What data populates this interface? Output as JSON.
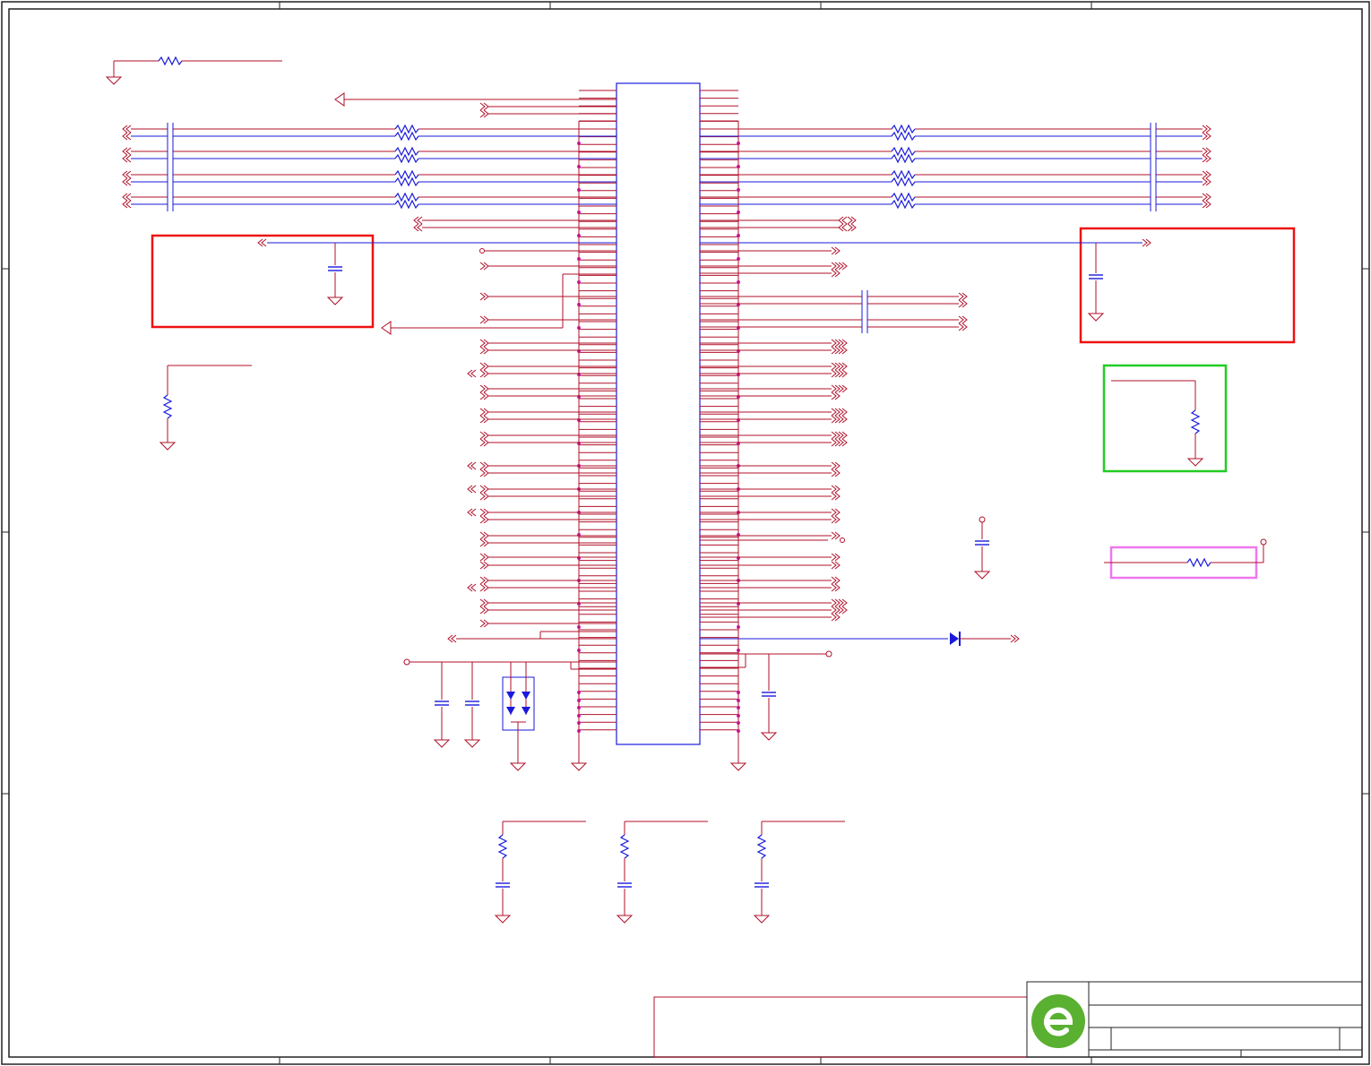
{
  "document": {
    "type": "schematic-sheet",
    "text_labels": []
  },
  "colors": {
    "wire": "#b0102a",
    "part": "#1a1adc",
    "junction": "#d21ed2",
    "frame": "#222222",
    "highlight_red": "#ee1111",
    "highlight_green": "#22cc22",
    "highlight_pink": "#ee77ee",
    "ic_body": "#1a1adc",
    "logo_green": "#5ab030"
  },
  "icons": {
    "logo": "company-logo-icon",
    "ground": "ground-symbol-icon",
    "resistor": "resistor-icon",
    "capacitor": "capacitor-icon",
    "diode": "diode-icon",
    "connector": "offpage-connector-icon"
  }
}
